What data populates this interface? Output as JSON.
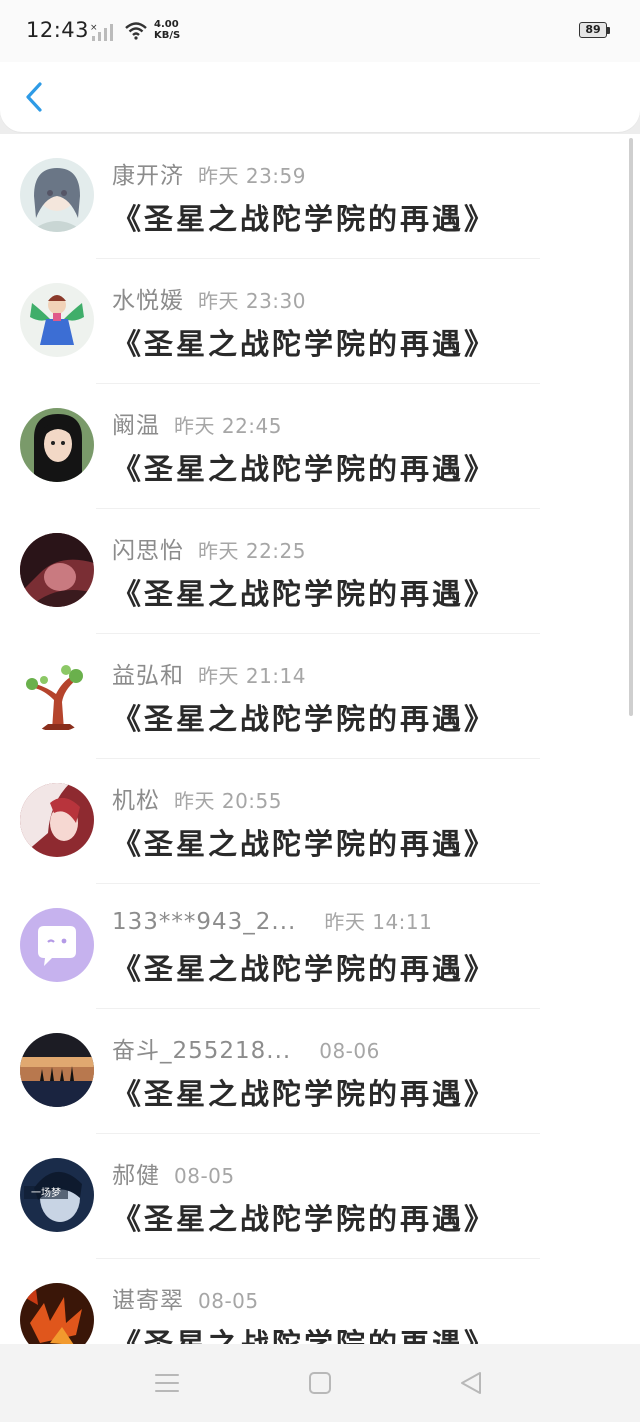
{
  "status_bar": {
    "time": "12:43",
    "speed_value": "4.00",
    "speed_unit": "KB/S",
    "battery": "89"
  },
  "header": {
    "back_icon": "chevron-left-icon",
    "accent": "#2e9be6"
  },
  "rows": [
    {
      "name": "康开济",
      "time": "昨天 23:59",
      "message": "《圣星之战陀学院的再遇》"
    },
    {
      "name": "水悦媛",
      "time": "昨天 23:30",
      "message": "《圣星之战陀学院的再遇》"
    },
    {
      "name": "阚温",
      "time": "昨天 22:45",
      "message": "《圣星之战陀学院的再遇》"
    },
    {
      "name": "闪思怡",
      "time": "昨天 22:25",
      "message": "《圣星之战陀学院的再遇》"
    },
    {
      "name": "益弘和",
      "time": "昨天 21:14",
      "message": "《圣星之战陀学院的再遇》"
    },
    {
      "name": "机松",
      "time": "昨天 20:55",
      "message": "《圣星之战陀学院的再遇》"
    },
    {
      "name": "133***943_2...",
      "time": "昨天 14:11",
      "message": "《圣星之战陀学院的再遇》"
    },
    {
      "name": "奋斗_255218...",
      "time": "08-06",
      "message": "《圣星之战陀学院的再遇》"
    },
    {
      "name": "郝健",
      "time": "08-05",
      "message": "《圣星之战陀学院的再遇》"
    },
    {
      "name": "谌寄翠",
      "time": "08-05",
      "message": "《圣星之战陀学院的再遇》"
    }
  ],
  "avatar_badge": "一场梦",
  "nav": {
    "menu_icon": "menu-icon",
    "home_icon": "home-square-icon",
    "back_icon": "back-triangle-icon"
  }
}
